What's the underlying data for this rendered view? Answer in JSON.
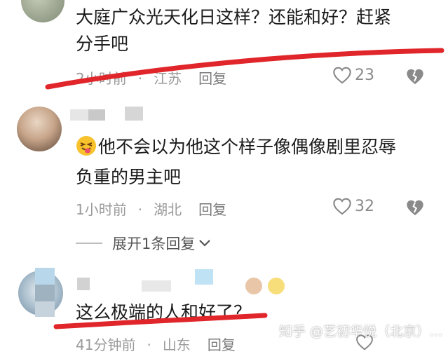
{
  "comments": [
    {
      "text_line1": "大庭广众光天化日这样？还能和好？赶紧",
      "text_line2": "分手吧",
      "time": "2小时前",
      "location": "江苏",
      "reply_label": "回复",
      "likes": "23"
    },
    {
      "text_line1": "他不会以为他这个样子像偶像剧里忍辱",
      "text_line2": "负重的男主吧",
      "time": "1小时前",
      "location": "湖北",
      "reply_label": "回复",
      "likes": "32",
      "expand_label": "展开1条回复"
    },
    {
      "text_line1": "这么极端的人和好了？",
      "time": "41分钟前",
      "location": "山东",
      "reply_label": "回复"
    }
  ],
  "watermark": "知乎 @艺初华悦（北京）...",
  "icons": {
    "like": "heart-outline-icon",
    "dislike": "broken-heart-icon",
    "emoji": "squinting-tongue-emoji-icon",
    "expand": "chevron-down-icon"
  },
  "colors": {
    "annotation": "#e0262b",
    "meta": "#9a9a9a"
  }
}
